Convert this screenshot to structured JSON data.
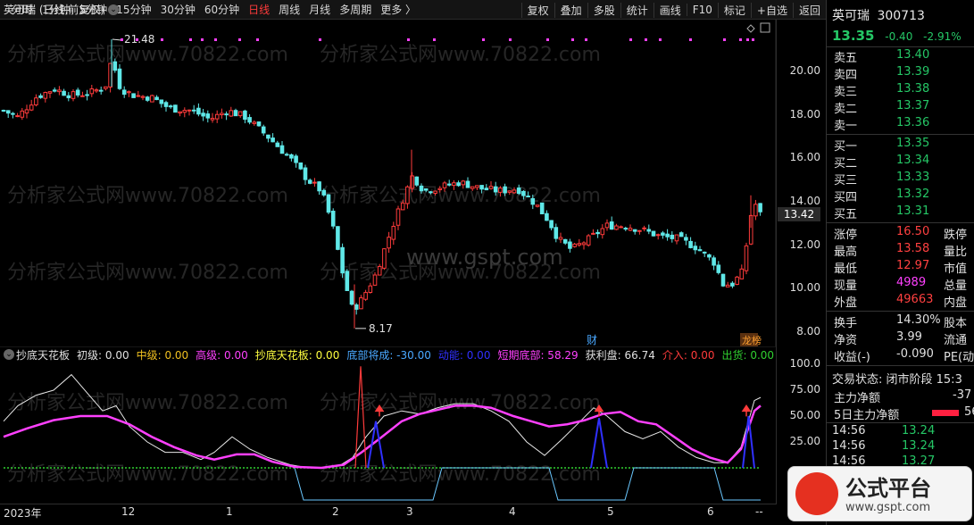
{
  "toolbar": {
    "periods": [
      "分时",
      "1分钟",
      "5分钟",
      "15分钟",
      "30分钟",
      "60分钟",
      "日线",
      "周线",
      "月线",
      "多周期",
      "更多 〉"
    ],
    "active_period": "日线",
    "tools": [
      "复权",
      "叠加",
      "多股",
      "统计",
      "画线",
      "F10",
      "标记",
      "+自选",
      "返回"
    ]
  },
  "chart": {
    "title": "英可瑞 (日线,前复权)",
    "high_label": "21.48",
    "low_label": "8.17",
    "price_axis": [
      "20.00",
      "18.00",
      "16.00",
      "14.00",
      "12.00",
      "10.00",
      "8.00"
    ],
    "current_price_tag": "13.42",
    "event_tag_cai": "财",
    "event_tag_bang": "龙榜",
    "watermark_1": "分析家公式网www.70822.com",
    "watermark_2": "www.gspt.com"
  },
  "indicator": {
    "name": "抄底天花板",
    "items": [
      {
        "label": "初级: 0.00",
        "color": "#e0e0e0"
      },
      {
        "label": "中级: 0.00",
        "color": "#f0c020"
      },
      {
        "label": "高级: 0.00",
        "color": "#ff40ff"
      },
      {
        "label": "抄底天花板: 0.00",
        "color": "#ffff40"
      },
      {
        "label": "底部将成: -30.00",
        "color": "#4aa8ff"
      },
      {
        "label": "动能: 0.00",
        "color": "#3030ff"
      },
      {
        "label": "短期底部: 58.29",
        "color": "#ff40ff"
      },
      {
        "label": "获利盘: 66.74",
        "color": "#e0e0e0"
      },
      {
        "label": "介入: 0.00",
        "color": "#ff3b3b"
      },
      {
        "label": "出货: 0.00",
        "color": "#30d030"
      }
    ],
    "axis": [
      "100.0",
      "75.00",
      "50.00",
      "25.00"
    ]
  },
  "dates": [
    "2023年",
    "12",
    "1",
    "2",
    "3",
    "4",
    "5",
    "6",
    "--"
  ],
  "quote": {
    "name": "英可瑞",
    "code": "300713",
    "price": "13.35",
    "change": "-0.40",
    "change_pct": "-2.91%",
    "asks": [
      {
        "label": "卖五",
        "price": "13.40"
      },
      {
        "label": "卖四",
        "price": "13.39"
      },
      {
        "label": "卖三",
        "price": "13.38"
      },
      {
        "label": "卖二",
        "price": "13.37"
      },
      {
        "label": "卖一",
        "price": "13.36"
      }
    ],
    "bids": [
      {
        "label": "买一",
        "price": "13.35"
      },
      {
        "label": "买二",
        "price": "13.34"
      },
      {
        "label": "买三",
        "price": "13.33"
      },
      {
        "label": "买四",
        "price": "13.32"
      },
      {
        "label": "买五",
        "price": "13.31"
      }
    ],
    "stats": [
      {
        "label": "涨停",
        "value": "16.50",
        "color": "#ff4040",
        "label2": "跌停"
      },
      {
        "label": "最高",
        "value": "13.58",
        "color": "#ff4040",
        "label2": "量比"
      },
      {
        "label": "最低",
        "value": "12.97",
        "color": "#ff4040",
        "label2": "市值"
      },
      {
        "label": "现量",
        "value": "4989",
        "color": "#ff40ff",
        "label2": "总量"
      },
      {
        "label": "外盘",
        "value": "49663",
        "color": "#ff4040",
        "label2": "内盘"
      }
    ],
    "stats2": [
      {
        "label": "换手",
        "value": "14.30%",
        "color": "#e0e0e0",
        "label2": "股本"
      },
      {
        "label": "净资",
        "value": "3.99",
        "color": "#e0e0e0",
        "label2": "流通"
      },
      {
        "label": "收益(-)",
        "value": "-0.090",
        "color": "#e0e0e0",
        "label2": "PE(动"
      }
    ],
    "trade_status": "交易状态: 闭市阶段  15:3",
    "main_flow_label": "主力净额",
    "main_flow_value": "-37",
    "flow5_label": "5日主力净额",
    "flow5_value": "56",
    "ticks": [
      {
        "time": "14:56",
        "price": "13.24"
      },
      {
        "time": "14:56",
        "price": "13.24"
      },
      {
        "time": "14:56",
        "price": "13.27"
      },
      {
        "time": "14:56",
        "price": "13.27"
      }
    ]
  },
  "logo": {
    "text": "公式平台",
    "url": "www.gspt.com"
  }
}
